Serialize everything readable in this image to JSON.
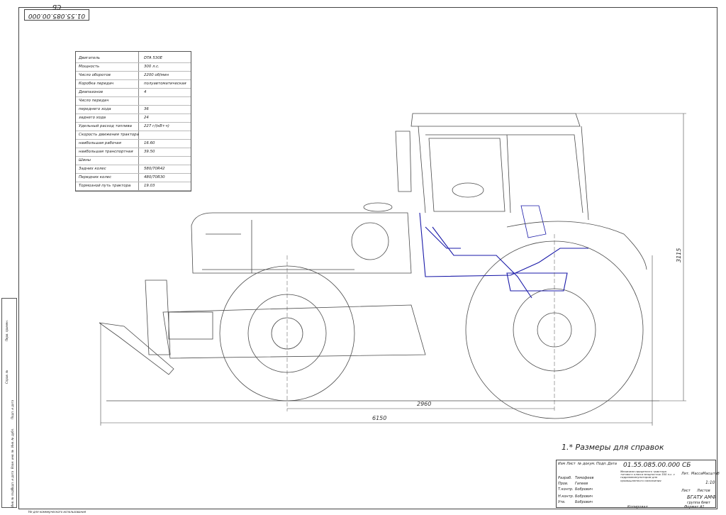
{
  "drawing_code_top": "01.55.085.00.000 СБ",
  "specs": [
    {
      "label": "Двигатель",
      "value": "DTA 530E"
    },
    {
      "label": "Мощность",
      "value": "300 л.с."
    },
    {
      "label": "Число оборотов",
      "value": "2200 об/мин"
    },
    {
      "label": "Коробка передач",
      "value": "полуавтоматическая"
    },
    {
      "label": "Диапазонов",
      "value": "4"
    },
    {
      "label": "Число передач",
      "value": ""
    },
    {
      "label": "переднего хода",
      "value": "36"
    },
    {
      "label": "заднего хода",
      "value": "24"
    },
    {
      "label": "Удельный расход топлива",
      "value": "227 г/(кВт·ч)"
    },
    {
      "label": "Скорость движения трактора",
      "value": ""
    },
    {
      "label": "наибольшая рабочая",
      "value": "16.60"
    },
    {
      "label": "наибольшая транспортная",
      "value": "39.50"
    },
    {
      "label": "Шины",
      "value": ""
    },
    {
      "label": "Задних колес",
      "value": "580/70R42"
    },
    {
      "label": "Передних колес",
      "value": "480/70R30"
    },
    {
      "label": "Тормозной путь трактора",
      "value": "19.03"
    }
  ],
  "dimensions": {
    "wheelbase": "2960",
    "length": "6150",
    "height": "3115"
  },
  "note": "1.* Размеры для справок",
  "title_block": {
    "code": "01.55.085.00.000 СБ",
    "description": "Механизм прицепного трактора тягового класса мощностью 300 л.с. с гидроманипулятором для промышленного назначения",
    "scale_label": "Масштаб",
    "scale": "1:10",
    "mass_label": "Масса",
    "lit_label": "Лит.",
    "sheet_label": "Лист",
    "sheets_label": "Листов",
    "org": "БГАТУ АМФ",
    "group": "группа 6мвт",
    "roles": [
      {
        "role": "Разраб.",
        "name": "Тимофеев"
      },
      {
        "role": "Пров.",
        "name": "Гапеев"
      },
      {
        "role": "Т.контр.",
        "name": "Бобрович"
      },
      {
        "role": "Н.контр.",
        "name": "Бобрович"
      },
      {
        "role": "Утв.",
        "name": "Бобрович"
      }
    ],
    "header_cells": [
      "Изм",
      "Лист",
      "№ докум.",
      "Подп.",
      "Дата"
    ],
    "format_label": "Формат",
    "format": "А1",
    "copied_label": "Копировал"
  },
  "left_strip": {
    "label1": "Перв. примен.",
    "label2": "Справ. №",
    "label3": "Подп. и дата",
    "label4": "Инв. № дубл.",
    "label5": "Взам. инв. №",
    "label6": "Подп. и дата",
    "label7": "Инв. № подл."
  },
  "bottom_note": "Не для коммерческого использования",
  "colors": {
    "line": "#4a4a4a",
    "highlight": "#1a1aa8"
  }
}
